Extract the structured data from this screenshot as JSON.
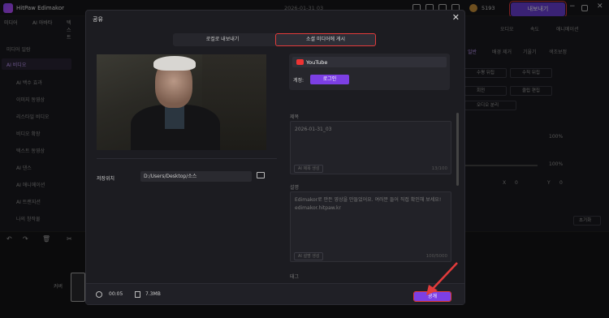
{
  "app": {
    "name": "HitPaw Edimakor",
    "date": "2026-01-31 03",
    "credits": "5193",
    "export_label": "내보내기"
  },
  "left_panel": {
    "tabs": [
      "미디어",
      "AI 아바타",
      "텍스트"
    ],
    "items": [
      "미디어 일람",
      "AI 비디오",
      "AI 백수 효과",
      "이미지 동영상",
      "리스타일 비디오",
      "비디오 확장",
      "텍스트 동영상",
      "AI 댄스",
      "AI 애니메이션",
      "AI 트랜지션",
      "나의 창작물"
    ]
  },
  "right_panel": {
    "tabs": [
      "오디오",
      "속도",
      "애니메이션"
    ],
    "sub_tabs": [
      "일반",
      "배경 제거",
      "기울기",
      "색조보정"
    ],
    "buttons": [
      "수평 뒤집",
      "수직 뒤집",
      "회전",
      "클립 편집",
      "오디오 분리"
    ],
    "labels": [
      "불투명도",
      "이동",
      "스케일"
    ],
    "values": [
      "100%",
      "100%"
    ],
    "x_label": "X",
    "x_val": "0",
    "y_label": "Y",
    "y_val": "0",
    "reset": "초기화"
  },
  "timeline": {
    "clip_label": "커버"
  },
  "dialog": {
    "title": "공유",
    "tab_local": "로컬로 내보내기",
    "tab_social": "소셜 미디어에 게시",
    "save_location_label": "저장위치",
    "save_path": "D:/Users/Desktop/소스",
    "platform": "YouTube",
    "account_label": "계정:",
    "login_button": "로그인",
    "title_label": "제목",
    "title_value": "2026-01-31_03",
    "title_ai_button": "AI 제목 생성",
    "title_count": "13/100",
    "desc_label": "설명",
    "desc_value": "Edimakor로 만든 영상을 만들었어요. 여러분 들어 직접 확인해 보세요! edimakor.hitpaw.kr",
    "desc_ai_button": "AI 설명 생성",
    "desc_count": "100/5000",
    "tag_label": "태그",
    "duration": "00:05",
    "file_size": "7.3MB",
    "publish_button": "공개"
  },
  "colors": {
    "accent": "#7c3fe4",
    "highlight": "#e23b3b"
  }
}
